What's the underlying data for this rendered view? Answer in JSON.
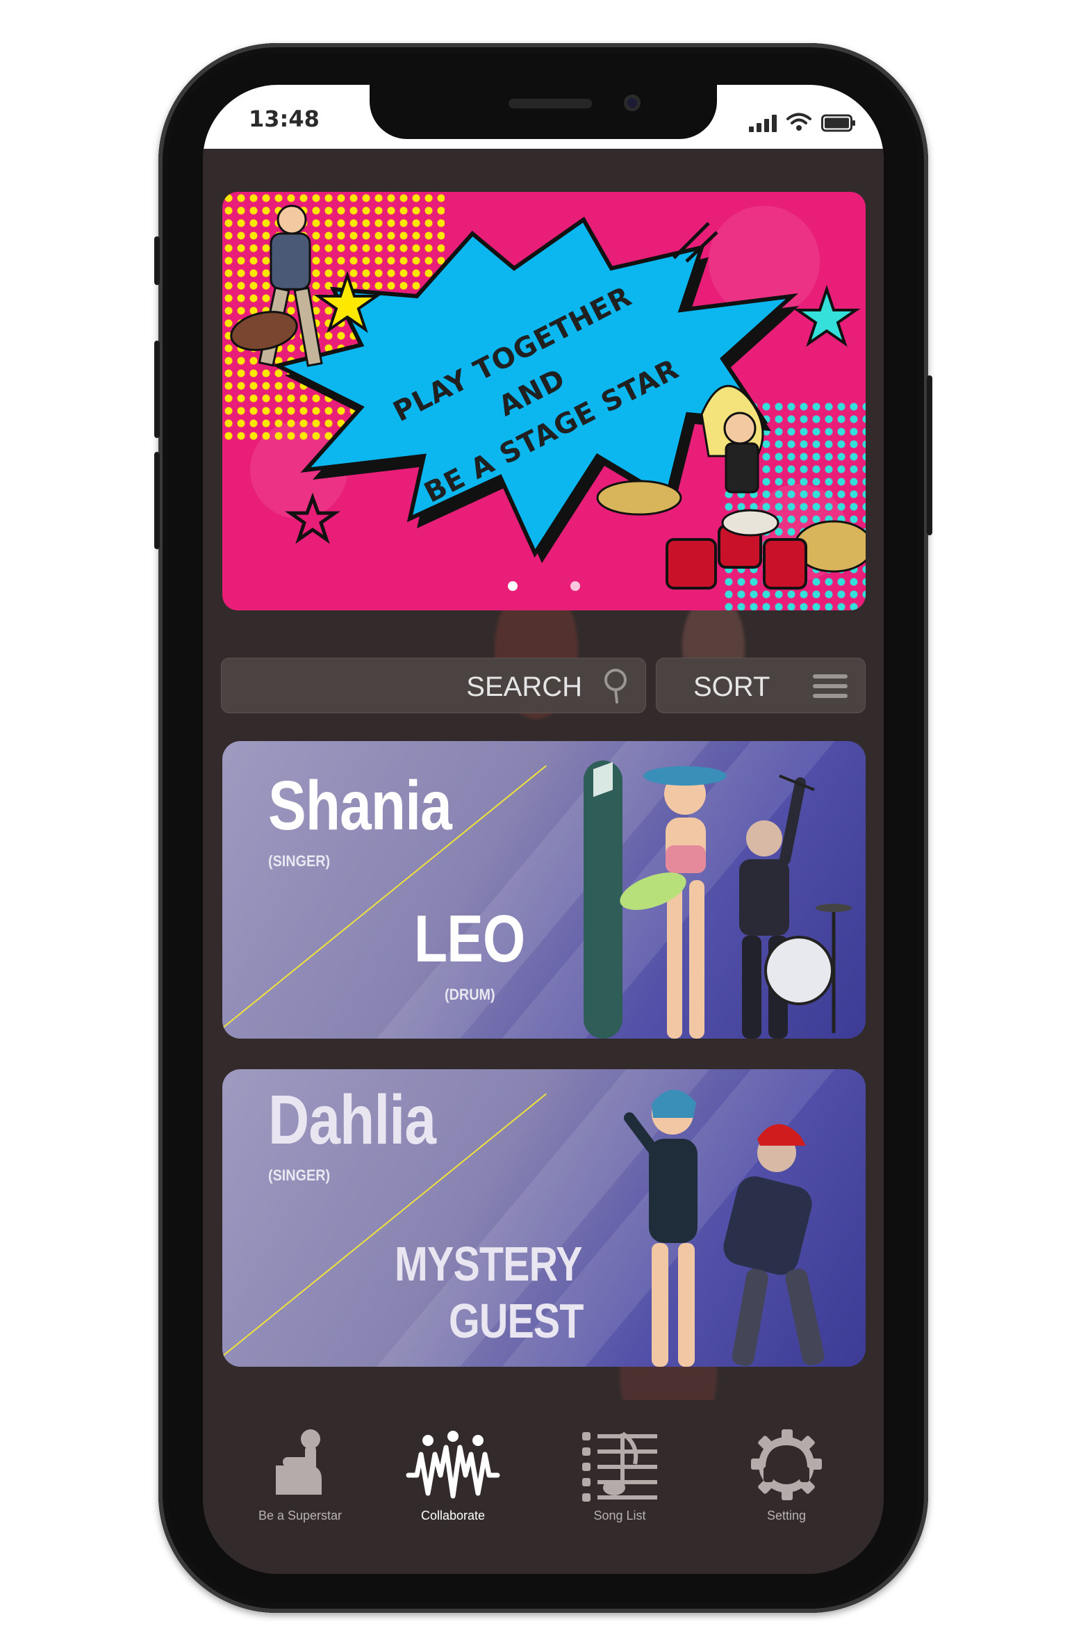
{
  "status_bar": {
    "time": "13:48",
    "icons": [
      "cellular-signal-icon",
      "wifi-icon",
      "battery-icon"
    ]
  },
  "banner": {
    "lines": [
      "PLAY TOGETHER",
      "AND",
      "BE A STAGE STAR"
    ],
    "page_dots": 2,
    "active_dot": 1,
    "colors": {
      "background": "#e91e79",
      "burst": "#0cb7f0",
      "halftone_yellow": "#ffe800",
      "halftone_cyan": "#34e0d9"
    }
  },
  "search": {
    "label": "SEARCH",
    "icon": "search-icon"
  },
  "sort": {
    "label": "SORT",
    "icon": "hamburger-menu-icon"
  },
  "cards": [
    {
      "name_1": "Shania",
      "role_1": "(SINGER)",
      "name_2": "LEO",
      "role_2": "(DRUM)"
    },
    {
      "name_1": "Dahlia",
      "role_1": "(SINGER)",
      "name_2_line1": "MYSTERY",
      "name_2_line2": "GUEST"
    }
  ],
  "nav": {
    "items": [
      {
        "label": "Be a Superstar",
        "icon": "microphone-hand-icon"
      },
      {
        "label": "Collaborate",
        "icon": "collaborate-people-icon",
        "active": true
      },
      {
        "label": "Song List",
        "icon": "song-list-icon"
      },
      {
        "label": "Setting",
        "icon": "gear-headphones-icon"
      }
    ]
  }
}
